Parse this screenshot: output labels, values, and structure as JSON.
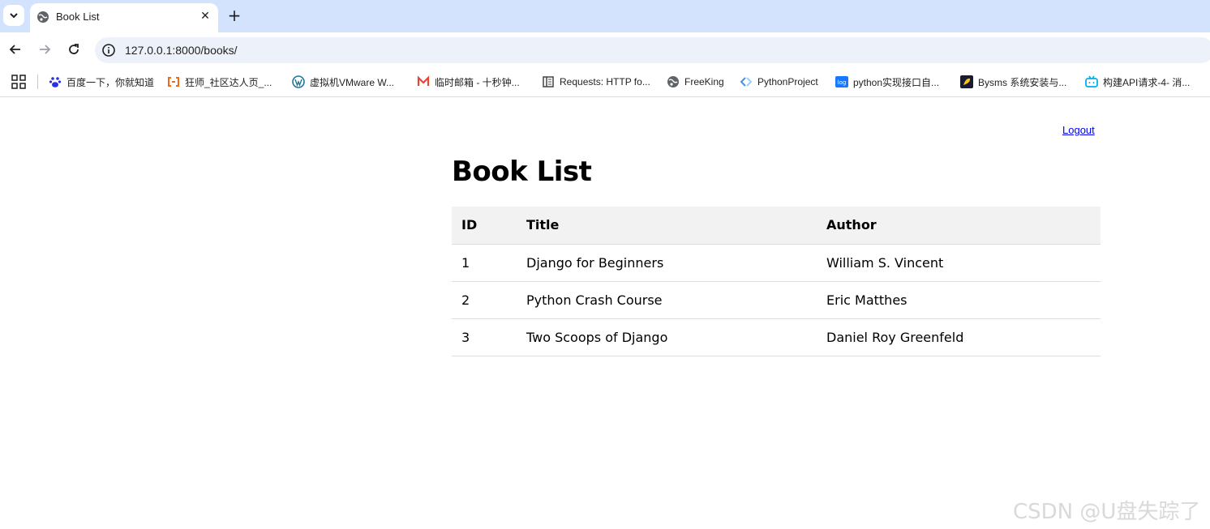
{
  "browser": {
    "tab": {
      "title": "Book List"
    },
    "address_bar": {
      "url": "127.0.0.1:8000/books/"
    },
    "bookmarks": [
      {
        "label": "百度一下，你就知道",
        "icon": "paw-icon"
      },
      {
        "label": "狂师_社区达人页_...",
        "icon": "bracket-logo-icon"
      },
      {
        "label": "虚拟机VMware W...",
        "icon": "wordpress-icon"
      },
      {
        "label": "临时邮箱 - 十秒钟...",
        "icon": "gmail-m-icon"
      },
      {
        "label": "Requests: HTTP fo...",
        "icon": "book-icon"
      },
      {
        "label": "FreeKing",
        "icon": "globe-icon"
      },
      {
        "label": "PythonProject",
        "icon": "diamond-code-icon"
      },
      {
        "label": "python实现接口自...",
        "icon": "log-badge-icon"
      },
      {
        "label": "Bysms 系统安装与...",
        "icon": "rocket-icon"
      },
      {
        "label": "构建API请求-4- 消...",
        "icon": "bilibili-tv-icon"
      }
    ]
  },
  "page": {
    "logout_label": "Logout",
    "title": "Book List",
    "table": {
      "headers": [
        "ID",
        "Title",
        "Author"
      ],
      "rows": [
        [
          "1",
          "Django for Beginners",
          "William S. Vincent"
        ],
        [
          "2",
          "Python Crash Course",
          "Eric Matthes"
        ],
        [
          "3",
          "Two Scoops of Django",
          "Daniel Roy Greenfeld"
        ]
      ]
    }
  },
  "watermark": "CSDN @U盘失踪了",
  "colors": {
    "tabstrip": "#d3e3fd",
    "omnibox": "#edf2fa",
    "link": "#0000ee",
    "table_header_bg": "#f2f2f2",
    "row_border": "#dddddd"
  }
}
